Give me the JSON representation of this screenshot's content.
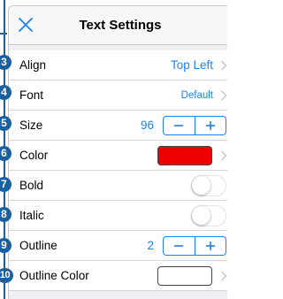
{
  "header": {
    "title": "Text Settings",
    "close_icon": "close-x-icon"
  },
  "rows": [
    {
      "key": "align",
      "badge": "3",
      "label": "Align",
      "value": "Top Left",
      "type": "link"
    },
    {
      "key": "font",
      "badge": "4",
      "label": "Font",
      "value": "Default",
      "type": "link"
    },
    {
      "key": "size",
      "badge": "5",
      "label": "Size",
      "value": "96",
      "type": "stepper",
      "minus": "−",
      "plus": "+"
    },
    {
      "key": "color",
      "badge": "6",
      "label": "Color",
      "swatch": "#ee0000",
      "type": "color"
    },
    {
      "key": "bold",
      "badge": "7",
      "label": "Bold",
      "on": false,
      "type": "toggle"
    },
    {
      "key": "italic",
      "badge": "8",
      "label": "Italic",
      "on": false,
      "type": "toggle"
    },
    {
      "key": "outline",
      "badge": "9",
      "label": "Outline",
      "value": "2",
      "type": "stepper",
      "minus": "−",
      "plus": "+"
    },
    {
      "key": "outline_color",
      "badge": "10",
      "label": "Outline Color",
      "swatch": "#ffffff",
      "type": "color"
    }
  ],
  "colors": {
    "accent": "#1a82f7",
    "badge": "#1a5fa0",
    "header_bg": "#f7f7f7",
    "separator": "#d6d6da"
  }
}
